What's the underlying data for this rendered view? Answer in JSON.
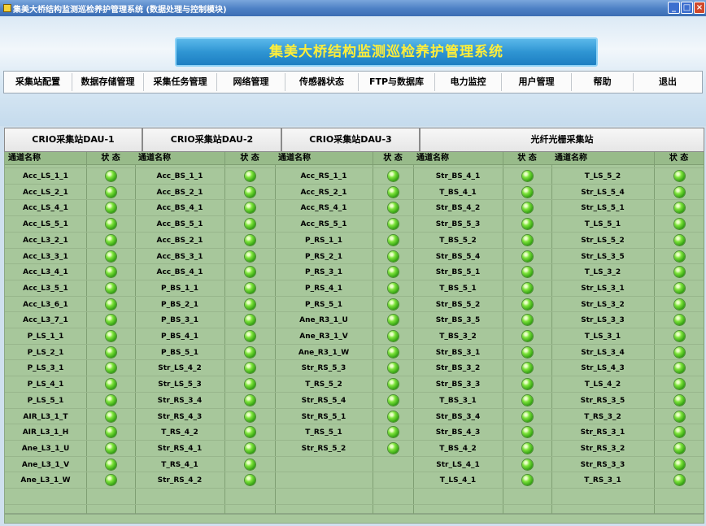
{
  "window": {
    "title": "集美大桥结构监测巡检养护管理系统 (数据处理与控制模块)",
    "controls": {
      "minimize": "_",
      "maximize": "□",
      "close": "×"
    }
  },
  "banner": {
    "title": "集美大桥结构监测巡检养护管理系统"
  },
  "menu": [
    "采集站配置",
    "数据存储管理",
    "采集任务管理",
    "网络管理",
    "传感器状态",
    "FTP与数据库",
    "电力监控",
    "用户管理",
    "帮助",
    "退出"
  ],
  "tabs": [
    "CRIO采集站DAU-1",
    "CRIO采集站DAU-2",
    "CRIO采集站DAU-3",
    "光纤光栅采集站"
  ],
  "headers": {
    "channel": "通道名称",
    "status": "状 态"
  },
  "status_color": "#4fd21f",
  "columns": [
    [
      "Acc_LS_1_1",
      "Acc_LS_2_1",
      "Acc_LS_4_1",
      "Acc_LS_5_1",
      "Acc_L3_2_1",
      "Acc_L3_3_1",
      "Acc_L3_4_1",
      "Acc_L3_5_1",
      "Acc_L3_6_1",
      "Acc_L3_7_1",
      "P_LS_1_1",
      "P_LS_2_1",
      "P_LS_3_1",
      "P_LS_4_1",
      "P_LS_5_1",
      "AIR_L3_1_T",
      "AIR_L3_1_H",
      "Ane_L3_1_U",
      "Ane_L3_1_V",
      "Ane_L3_1_W"
    ],
    [
      "Acc_BS_1_1",
      "Acc_BS_2_1",
      "Acc_BS_4_1",
      "Acc_BS_5_1",
      "Acc_BS_2_1",
      "Acc_BS_3_1",
      "Acc_BS_4_1",
      "P_BS_1_1",
      "P_BS_2_1",
      "P_BS_3_1",
      "P_BS_4_1",
      "P_BS_5_1",
      "Str_LS_4_2",
      "Str_LS_5_3",
      "Str_RS_3_4",
      "Str_RS_4_3",
      "T_RS_4_2",
      "Str_RS_4_1",
      "T_RS_4_1",
      "Str_RS_4_2"
    ],
    [
      "Acc_RS_1_1",
      "Acc_RS_2_1",
      "Acc_RS_4_1",
      "Acc_RS_5_1",
      "P_RS_1_1",
      "P_RS_2_1",
      "P_RS_3_1",
      "P_RS_4_1",
      "P_RS_5_1",
      "Ane_R3_1_U",
      "Ane_R3_1_V",
      "Ane_R3_1_W",
      "Str_RS_5_3",
      "T_RS_5_2",
      "Str_RS_5_4",
      "Str_RS_5_1",
      "T_RS_5_1",
      "Str_RS_5_2"
    ],
    [
      "Str_BS_4_1",
      "T_BS_4_1",
      "Str_BS_4_2",
      "Str_BS_5_3",
      "T_BS_5_2",
      "Str_BS_5_4",
      "Str_BS_5_1",
      "T_BS_5_1",
      "Str_BS_5_2",
      "Str_BS_3_5",
      "T_BS_3_2",
      "Str_BS_3_1",
      "Str_BS_3_2",
      "Str_BS_3_3",
      "T_BS_3_1",
      "Str_BS_3_4",
      "Str_BS_4_3",
      "T_BS_4_2",
      "Str_LS_4_1",
      "T_LS_4_1"
    ],
    [
      "T_LS_5_2",
      "Str_LS_5_4",
      "Str_LS_5_1",
      "T_LS_5_1",
      "Str_LS_5_2",
      "Str_LS_3_5",
      "T_LS_3_2",
      "Str_LS_3_1",
      "Str_LS_3_2",
      "Str_LS_3_3",
      "T_LS_3_1",
      "Str_LS_3_4",
      "Str_LS_4_3",
      "T_LS_4_2",
      "Str_RS_3_5",
      "T_RS_3_2",
      "Str_RS_3_1",
      "Str_RS_3_2",
      "Str_RS_3_3",
      "T_RS_3_1"
    ]
  ]
}
